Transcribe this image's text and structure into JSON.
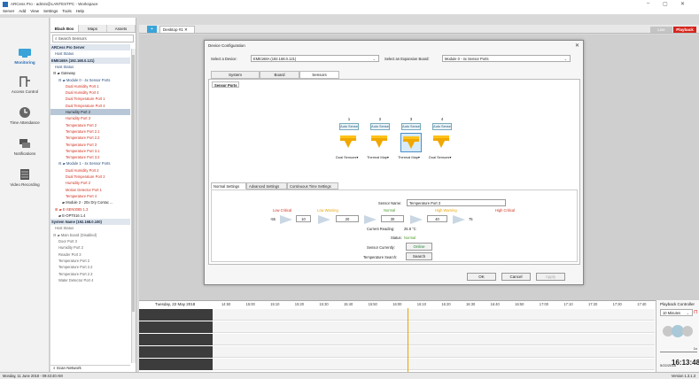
{
  "app": {
    "title": "ARCess Pro - admin@LANTESTPC - Workspace",
    "menu": [
      "Server",
      "Add",
      "View",
      "Settings",
      "Tools",
      "Help"
    ]
  },
  "rail": {
    "items": [
      {
        "label": "Monitoring"
      },
      {
        "label": "Access Control"
      },
      {
        "label": "Time Attendance"
      },
      {
        "label": "Notifications"
      },
      {
        "label": "Video Recording"
      }
    ]
  },
  "tree": {
    "tabs": [
      "Black Box",
      "Maps",
      "Assets"
    ],
    "search_placeholder": "Search Sensors",
    "rows": [
      {
        "text": "ARCess Pro Server",
        "cls": "hdr",
        "indent": 1
      },
      {
        "text": "Host Status",
        "cls": "blue",
        "indent": 5
      },
      {
        "text": "EME168A (192.168.0.121)",
        "cls": "hdr",
        "indent": 1
      },
      {
        "text": "Host Status",
        "cls": "blue",
        "indent": 5
      },
      {
        "text": "⊟ ▰ Gateway",
        "cls": "",
        "indent": 3
      },
      {
        "text": "⊟ ▰ Module 0 - 4x Sensor Ports",
        "cls": "blue",
        "indent": 9
      },
      {
        "text": "Dual Humidity Port 1",
        "cls": "red",
        "indent": 17
      },
      {
        "text": "Dual Humidity Port 4",
        "cls": "red",
        "indent": 17
      },
      {
        "text": "Dual Temperature Port 1",
        "cls": "red",
        "indent": 17
      },
      {
        "text": "Dual Temperature Port 4",
        "cls": "red",
        "indent": 17
      },
      {
        "text": "Humidity Port 2",
        "cls": "sel",
        "indent": 17
      },
      {
        "text": "Humidity Port 3",
        "cls": "red",
        "indent": 17
      },
      {
        "text": "Temperature Port 2",
        "cls": "red",
        "indent": 17
      },
      {
        "text": "Temperature Port 2.1",
        "cls": "red",
        "indent": 17
      },
      {
        "text": "Temperature Port 2.2",
        "cls": "red",
        "indent": 17
      },
      {
        "text": "Temperature Port 3",
        "cls": "red",
        "indent": 17
      },
      {
        "text": "Temperature Port 3.1",
        "cls": "red",
        "indent": 17
      },
      {
        "text": "Temperature Port 3.2",
        "cls": "red",
        "indent": 17
      },
      {
        "text": "⊟ ▰ Module 1 - 4x Sensor Ports",
        "cls": "blue",
        "indent": 9
      },
      {
        "text": "Dual Humidity Port 2",
        "cls": "red",
        "indent": 17
      },
      {
        "text": "Dual Temperature Port 2",
        "cls": "red",
        "indent": 17
      },
      {
        "text": "Humidity Port 2",
        "cls": "red",
        "indent": 17
      },
      {
        "text": "Motion Detector Port 1",
        "cls": "red",
        "indent": 17
      },
      {
        "text": "Temperature Port 4",
        "cls": "red",
        "indent": 17
      },
      {
        "text": "▰ Module 2 - 20x Dry Contac ...",
        "cls": "",
        "indent": 13
      },
      {
        "text": "⊞ ▰ E-SEN0085 1.3",
        "cls": "red",
        "indent": 5
      },
      {
        "text": "▰ E-OPT016 1.4",
        "cls": "",
        "indent": 9
      },
      {
        "text": "System Name (192.168.0.100)",
        "cls": "hdr",
        "indent": 1
      },
      {
        "text": "Host Status",
        "cls": "grey",
        "indent": 5
      },
      {
        "text": "⊟ ▰ Main board (Disabled)",
        "cls": "grey",
        "indent": 3
      },
      {
        "text": "Door Port 3",
        "cls": "grey",
        "indent": 9
      },
      {
        "text": "Humidity Port 2",
        "cls": "grey",
        "indent": 9
      },
      {
        "text": "Reader Port 3",
        "cls": "grey",
        "indent": 9
      },
      {
        "text": "Temperature Port 2",
        "cls": "grey",
        "indent": 9
      },
      {
        "text": "Temperature Port 2.2",
        "cls": "grey",
        "indent": 9
      },
      {
        "text": "Temperature Port 2.3",
        "cls": "grey",
        "indent": 9
      },
      {
        "text": "Water Detector Port 4",
        "cls": "grey",
        "indent": 9
      }
    ],
    "scan": "Scan Network"
  },
  "toolbar": {
    "desktop_tab": "Desktop #1",
    "live": "Live",
    "playback": "Playback"
  },
  "dialog": {
    "title": "Device Configuration",
    "select_device_label": "Select a Device:",
    "select_device_value": "EME168A (192.168.0.121)",
    "expansion_label": "Select an Expansion Board:",
    "expansion_value": "Module 0 - 4x Sensor Ports",
    "tabs": [
      "System",
      "Board",
      "Sensors"
    ],
    "sensor_ports_tab": "Sensor Ports",
    "ports": [
      {
        "num": "1",
        "mode": "Auto Sense",
        "label": "Dual Sensors▾",
        "selected": false
      },
      {
        "num": "2",
        "mode": "Auto Sense",
        "label": "Thermal Map▾",
        "selected": false
      },
      {
        "num": "3",
        "mode": "Auto Sense",
        "label": "Thermal Map▾",
        "selected": true
      },
      {
        "num": "4",
        "mode": "Auto Sense",
        "label": "Dual Sensors▾",
        "selected": false
      }
    ],
    "settings_tabs": [
      "Normal Settings",
      "Advanced Settings",
      "Continuous Time Settings"
    ],
    "sensor_name_label": "Sensor Name:",
    "sensor_name": "Temperature Port 3",
    "thresholds": {
      "low_critical": "Low Critical",
      "low_warning": "Low Warning",
      "normal": "Normal",
      "high_warning": "High Warning",
      "high_critical": "High Critical",
      "min": "-55",
      "v1": "10",
      "v2": "20",
      "v3": "30",
      "v4": "40",
      "max": "75"
    },
    "current_reading_label": "Current Reading:",
    "current_reading": "25.8 °C",
    "status_label": "Status:",
    "status": "Normal",
    "sensor_currently_label": "Sensor Currently:",
    "sensor_currently": "Online",
    "temp_search_label": "Temperature Search:",
    "search_btn": "Search",
    "ok": "OK",
    "cancel": "Cancel",
    "apply": "Apply"
  },
  "timeline": {
    "date": "Tuesday, 22 May 2018",
    "ticks": [
      "14:50",
      "15:00",
      "15:10",
      "15:20",
      "15:30",
      "15:40",
      "15:50",
      "16:00",
      "16:10",
      "16:20",
      "16:30",
      "16:40",
      "16:50",
      "17:00",
      "17:10",
      "17:20",
      "17:30",
      "17:40"
    ]
  },
  "playback": {
    "title": "Playback Controller",
    "interval": "10 Minutes",
    "speed": "1x",
    "date": "5/22/2018",
    "time": "16:13:48",
    "ampm": "PM",
    "skip_gaps": "Skip Gaps"
  },
  "status": {
    "left": "Monday, 11 June 2018 - 09:43:40 AM",
    "right": "Version 1.3.1.3"
  },
  "colors": {
    "red": "#d0311f",
    "orange": "#e8a400",
    "green": "#4d9a2a",
    "accent": "#d6241b"
  }
}
